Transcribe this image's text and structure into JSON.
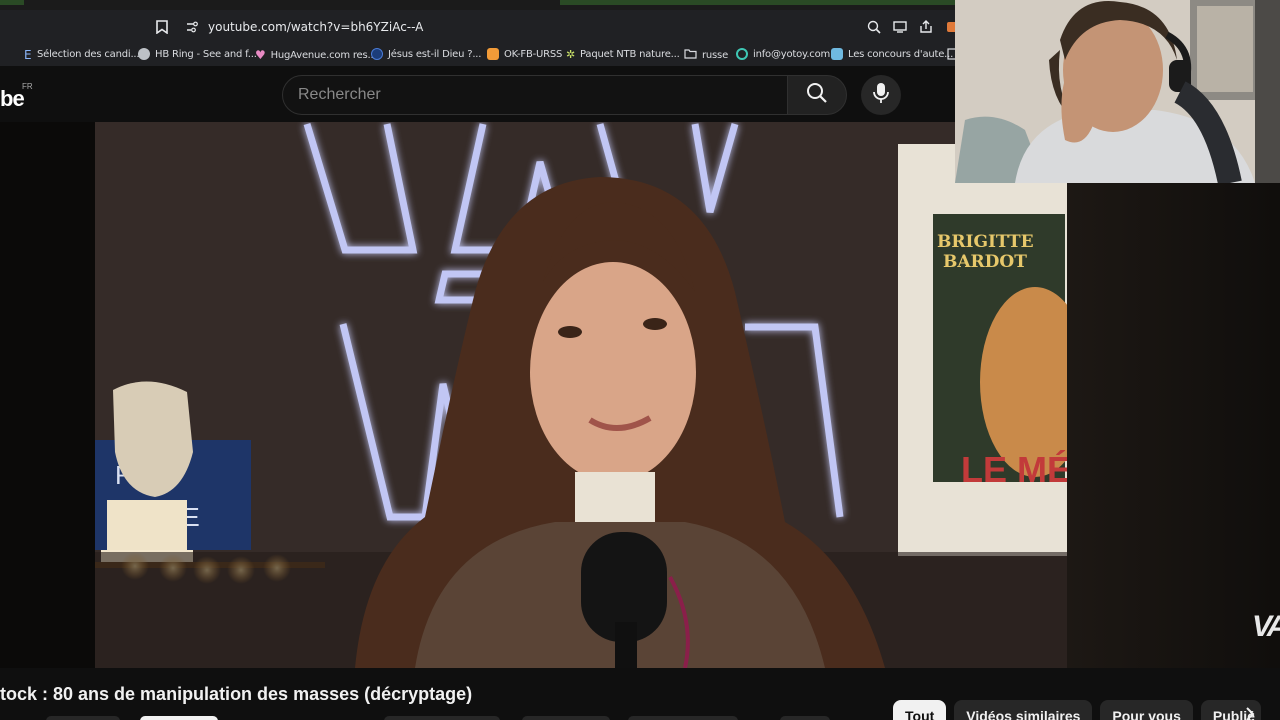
{
  "browser": {
    "url": "youtube.com/watch?v=bh6YZiAc--A",
    "bookmarks": [
      {
        "label": "Sélection des candi...",
        "color": "#8ab4f8"
      },
      {
        "label": "HB Ring - See and f...",
        "color": "#bdc1c6"
      },
      {
        "label": "HugAvenue.com res...",
        "color": "#e88ac4"
      },
      {
        "label": "Jésus est-il Dieu ?...",
        "color": "#4a7bd6"
      },
      {
        "label": "OK-FB-URSS",
        "color": "#f29b38"
      },
      {
        "label": "Paquet NTB nature...",
        "color": "#cbe36a"
      },
      {
        "label": "russe",
        "color": "#bdc1c6"
      },
      {
        "label": "info@yotoy.com",
        "color": "#3ec7b4"
      },
      {
        "label": "Les concours d'aute...",
        "color": "#6fb9e0"
      }
    ]
  },
  "youtube": {
    "logo_text": "be",
    "region": "FR",
    "search_placeholder": "Rechercher"
  },
  "video": {
    "title": "tock : 80 ans de manipulation des masses (décryptage)",
    "poster_text": {
      "line1": "BRIGITTE",
      "line2": "BARDOT",
      "line3": "LE MÉ"
    },
    "sign_text": {
      "line1": "RVE",
      "line2": "SE"
    },
    "watermark": "VA"
  },
  "chips": [
    "Tout",
    "Vidéos similaires",
    "Pour vous",
    "Publié"
  ],
  "colors": {
    "neon": "#a9b6ff",
    "background": "#0f0f0f",
    "chip_active": "#f1f1f1"
  }
}
